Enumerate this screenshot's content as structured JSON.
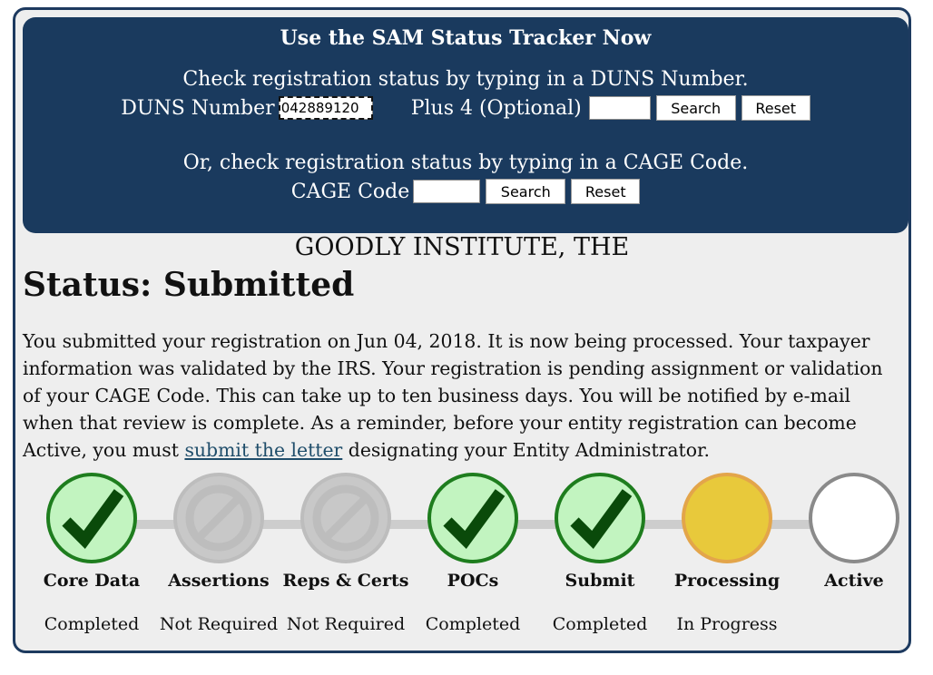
{
  "tracker": {
    "title": "Use the SAM Status Tracker Now",
    "duns_instruction": "Check registration status by typing in a DUNS Number.",
    "duns_label": "DUNS Number",
    "duns_value": "042889120",
    "plus4_label": "Plus 4 (Optional)",
    "plus4_value": "",
    "search_label": "Search",
    "reset_label": "Reset",
    "cage_instruction": "Or, check registration status by typing in a CAGE Code.",
    "cage_label": "CAGE Code",
    "cage_value": ""
  },
  "entity": {
    "name": "GOODLY INSTITUTE, THE"
  },
  "status": {
    "heading": "Status: Submitted",
    "text_before_link": "You submitted your registration on Jun 04, 2018. It is now being processed. Your taxpayer information was validated by the IRS. Your registration is pending assignment or validation of your CAGE Code. This can take up to ten business days. You will be notified by e-mail when that review is complete. As a reminder, before your entity registration can become Active, you must ",
    "link_text": "submit the letter",
    "text_after_link": " designating your Entity Administrator."
  },
  "steps": [
    {
      "name": "Core Data",
      "status": "Completed",
      "state": "completed",
      "icon": "checkmark-icon"
    },
    {
      "name": "Assertions",
      "status": "Not Required",
      "state": "not-required",
      "icon": "not-required-icon"
    },
    {
      "name": "Reps & Certs",
      "status": "Not Required",
      "state": "not-required",
      "icon": "not-required-icon"
    },
    {
      "name": "POCs",
      "status": "Completed",
      "state": "completed",
      "icon": "checkmark-icon"
    },
    {
      "name": "Submit",
      "status": "Completed",
      "state": "completed",
      "icon": "checkmark-icon"
    },
    {
      "name": "Processing",
      "status": "In Progress",
      "state": "in-progress",
      "icon": "in-progress-icon"
    },
    {
      "name": "Active",
      "status": "",
      "state": "pending",
      "icon": "pending-icon"
    }
  ],
  "colors": {
    "panel": "#1a3a5e",
    "completed_fill": "#c2f4c0",
    "completed_border": "#1e7d1e",
    "checkmark": "#0a4a0a",
    "in_progress_fill": "#e8c93b",
    "not_required": "#c8c8c8"
  }
}
